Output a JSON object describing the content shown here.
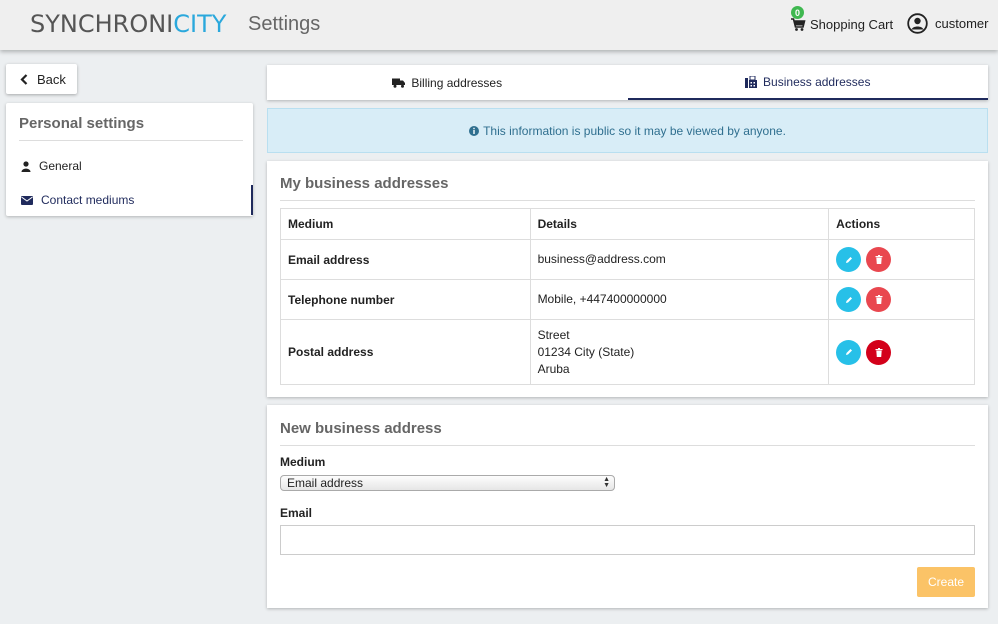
{
  "header": {
    "logo_main": "SYNCHRONI",
    "logo_accent": "CITY",
    "title": "Settings",
    "cart_count": "0",
    "cart_label": "Shopping Cart",
    "user_label": "customer"
  },
  "sidebar": {
    "back_label": "Back",
    "card_title": "Personal settings",
    "items": [
      {
        "label": "General",
        "icon": "user-icon"
      },
      {
        "label": "Contact mediums",
        "icon": "envelope-icon",
        "active": true
      }
    ]
  },
  "tabs": [
    {
      "label": "Billing addresses",
      "icon": "truck-icon"
    },
    {
      "label": "Business addresses",
      "icon": "fax-icon",
      "active": true
    }
  ],
  "info_banner": "This information is public so it may be viewed by anyone.",
  "addresses": {
    "title": "My business addresses",
    "columns": [
      "Medium",
      "Details",
      "Actions"
    ],
    "rows": [
      {
        "medium": "Email address",
        "details": [
          "business@address.com"
        ]
      },
      {
        "medium": "Telephone number",
        "details": [
          "Mobile, +447400000000"
        ]
      },
      {
        "medium": "Postal address",
        "details": [
          "Street",
          "01234 City (State)",
          "Aruba"
        ]
      }
    ]
  },
  "new_address": {
    "title": "New business address",
    "medium_label": "Medium",
    "medium_value": "Email address",
    "email_label": "Email",
    "email_value": "",
    "create_label": "Create"
  },
  "colors": {
    "accent": "#2aa8dc",
    "active_nav": "#1f2a5c",
    "edit": "#27c0e8",
    "delete": "#e9474f",
    "create": "#fbc367",
    "badge": "#3fb850"
  }
}
